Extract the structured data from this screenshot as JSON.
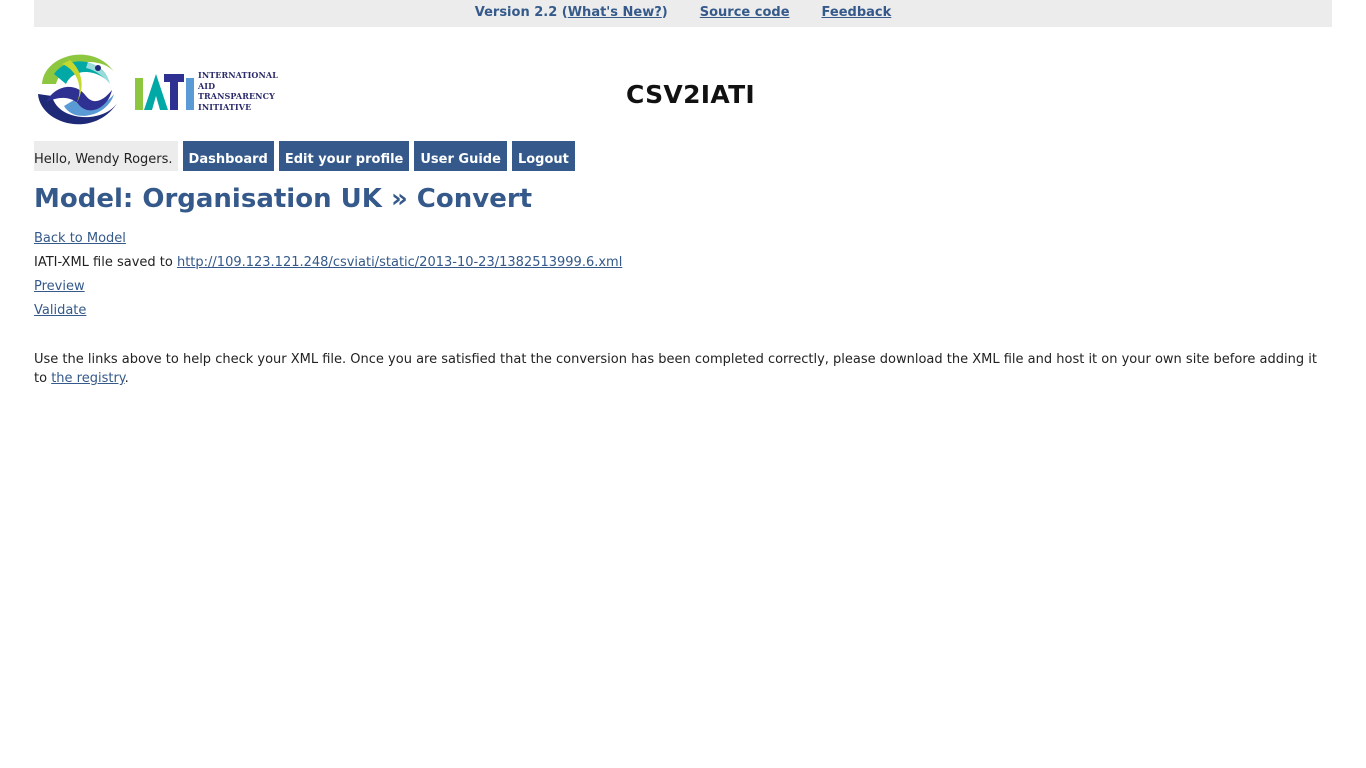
{
  "topbar": {
    "version_text": "Version 2.2 (",
    "whats_new": "What's New?",
    "version_close": ")",
    "source_code": "Source code",
    "feedback": "Feedback"
  },
  "logo": {
    "line1": "INTERNATIONAL",
    "line2": "AID",
    "line3": "TRANSPARENCY",
    "line4": "INITIATIVE",
    "mark_text": "IATI"
  },
  "app_title": "CSV2IATI",
  "nav": {
    "greeting": "Hello, Wendy Rogers.",
    "items": [
      "Dashboard",
      "Edit your profile",
      "User Guide",
      "Logout"
    ]
  },
  "page": {
    "heading": "Model: Organisation UK » Convert",
    "back_link": "Back to Model",
    "saved_prefix": "IATI-XML file saved to ",
    "saved_url": "http://109.123.121.248/csviati/static/2013-10-23/1382513999.6.xml",
    "preview_link": "Preview",
    "validate_link": "Validate",
    "info_text": "Use the links above to help check your XML file. Once you are satisfied that the conversion has been completed correctly, please download the XML file and host it on your own site before adding it to ",
    "registry_link": "the registry",
    "info_end": "."
  },
  "colors": {
    "link": "#34598a",
    "nav_bg": "#34598a",
    "bar_bg": "#ececec"
  }
}
